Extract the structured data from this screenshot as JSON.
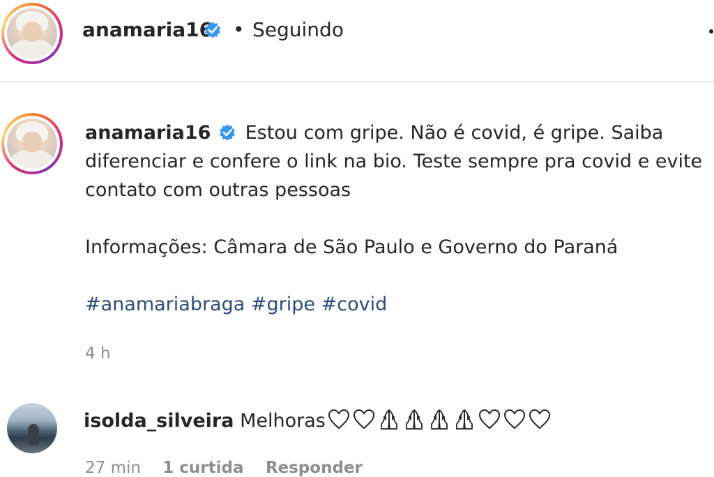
{
  "header": {
    "username": "anamaria16",
    "separator": "•",
    "follow_status": "Seguindo"
  },
  "post": {
    "username": "anamaria16",
    "caption_lines": [
      "Estou com gripe. Não é covid, é gripe. Saiba",
      "diferenciar e confere o link na bio. Teste sempre pra covid e evite",
      "contato com outras pessoas"
    ],
    "info": "Informações: Câmara de São Paulo e Governo do Paraná",
    "hashtags": [
      "#anamariabraga",
      "#gripe",
      "#covid"
    ],
    "time": "4 h"
  },
  "comment": {
    "username": "isolda_silveira",
    "text": "Melhoras",
    "emojis": [
      "heart-outline",
      "heart-outline",
      "praying-hands",
      "praying-hands",
      "praying-hands",
      "praying-hands",
      "heart-outline",
      "heart-outline",
      "heart-outline"
    ],
    "time": "27 min",
    "likes": "1 curtida",
    "reply": "Responder"
  },
  "colors": {
    "verified": "#3897f0",
    "hashtag": "#2c4b7c",
    "secondary_text": "#8e8e8e"
  }
}
